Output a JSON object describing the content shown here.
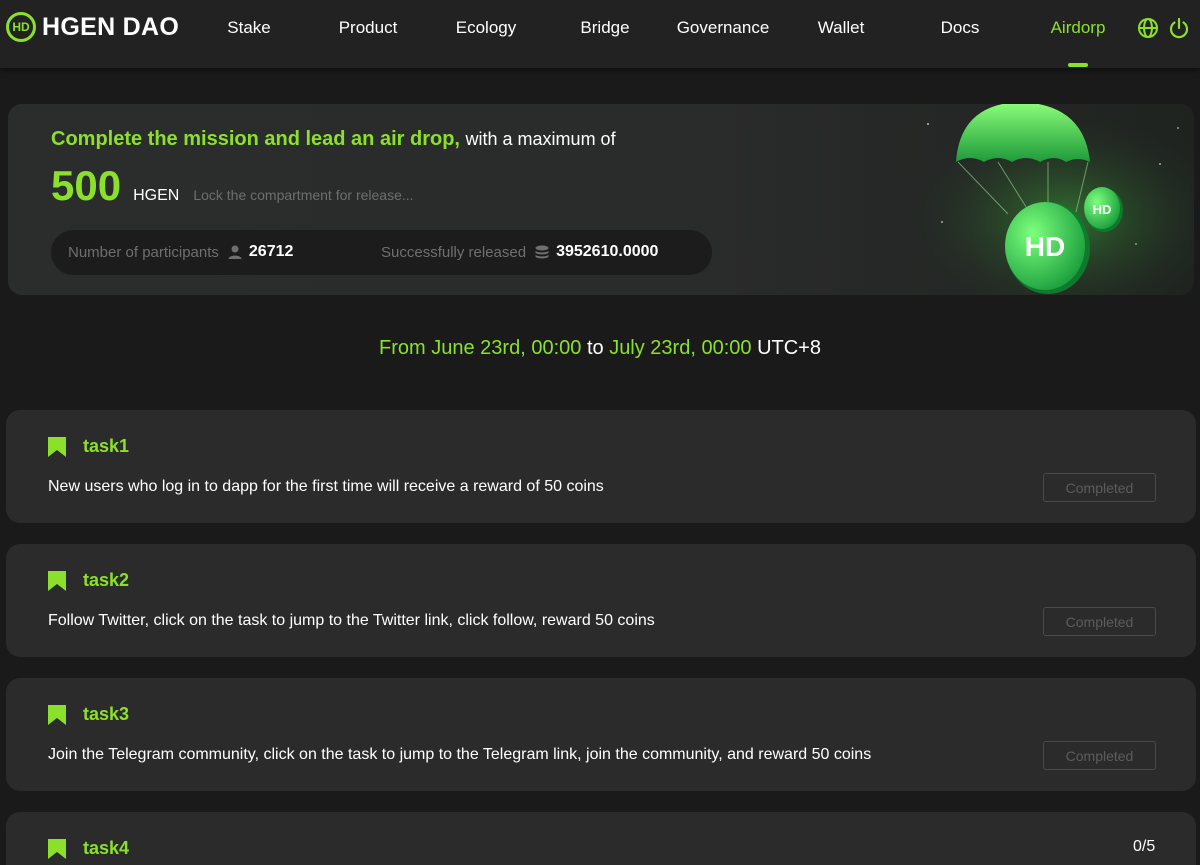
{
  "brand": {
    "mark": "HD",
    "name": "HGEN DAO"
  },
  "nav": {
    "items": [
      "Stake",
      "Product",
      "Ecology",
      "Bridge",
      "Governance",
      "Wallet",
      "Docs",
      "Airdorp"
    ],
    "active": "Airdorp",
    "icons": [
      "globe-icon",
      "power-icon"
    ]
  },
  "hero": {
    "title_highlight": "Complete the mission and lead an air drop,",
    "title_rest": "with a maximum of",
    "amount": "500",
    "unit": "HGEN",
    "note": "Lock the compartment for release...",
    "participants_label": "Number of participants",
    "participants_value": "26712",
    "released_label": "Successfully released",
    "released_value": "3952610.0000",
    "art_coin_mark": "HD"
  },
  "period": {
    "from_label": "From",
    "from_date": "June 23rd, 00:00",
    "to_word": "to",
    "to_date": "July 23rd, 00:00",
    "timezone": "UTC+8"
  },
  "tasks": [
    {
      "name": "task1",
      "description": "New users who log in to dapp for the first time will receive a reward of 50 coins",
      "status": "Completed"
    },
    {
      "name": "task2",
      "description": "Follow Twitter, click on the task to jump to the Twitter link, click follow, reward 50 coins",
      "status": "Completed"
    },
    {
      "name": "task3",
      "description": "Join the Telegram community, click on the task to jump to the Telegram link, join the community, and reward 50 coins",
      "status": "Completed"
    },
    {
      "name": "task4",
      "progress": "0/5"
    }
  ],
  "colors": {
    "accent": "#8be02b",
    "background": "#1a1a1a",
    "card": "#2b2b2b",
    "nav": "#222222"
  }
}
